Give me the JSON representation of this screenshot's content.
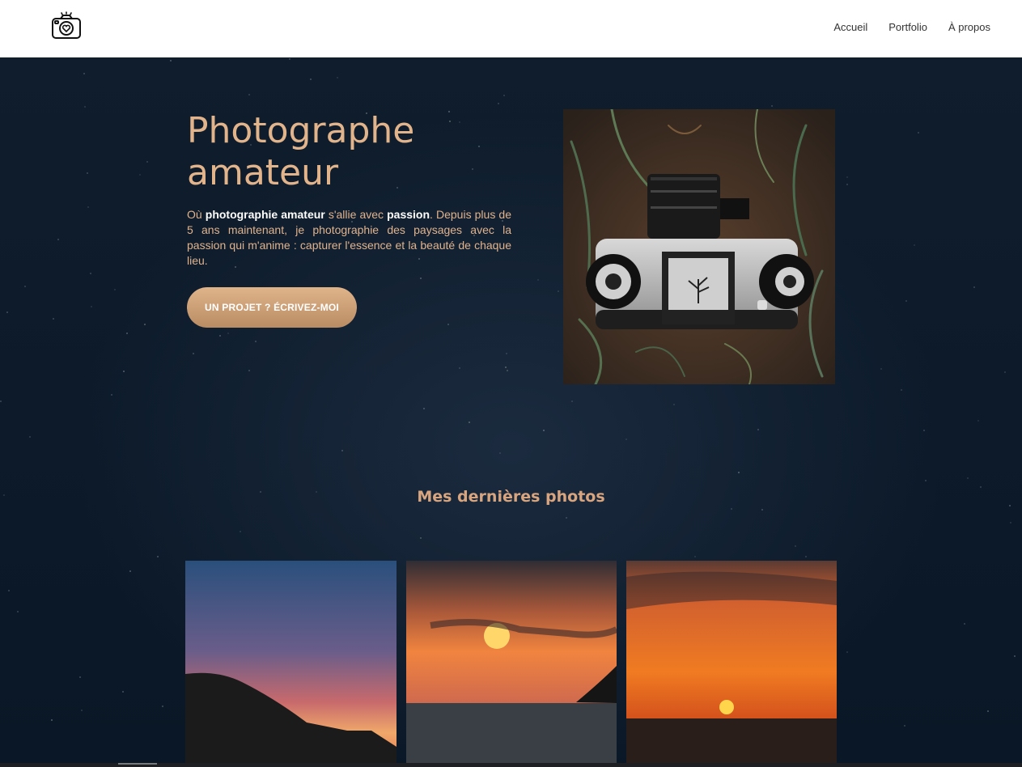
{
  "nav": {
    "items": [
      "Accueil",
      "Portfolio",
      "À propos"
    ]
  },
  "hero": {
    "title": "Photographe amateur",
    "text_parts": {
      "p1": "Où ",
      "b1": "photographie amateur",
      "p2": " s'allie avec ",
      "b2": "passion",
      "p3": ". Depuis plus de 5 ans maintenant, je photographie des paysages avec la passion qui m'anime : capturer l'essence et la beauté de chaque lieu."
    },
    "cta_label": "UN PROJET ?  ÉCRIVEZ-MOI",
    "photo_icon": "vintage-camera-photo"
  },
  "gallery": {
    "title": "Mes dernières photos",
    "photos": [
      "sunset-coast-silhouette",
      "sunset-sea-island",
      "orange-sunset-sea"
    ]
  },
  "colors": {
    "accent": "#e2b48c",
    "background": "#0c1a2a",
    "header_bg": "#ffffff"
  },
  "logo_icon": "camera-heart-icon"
}
